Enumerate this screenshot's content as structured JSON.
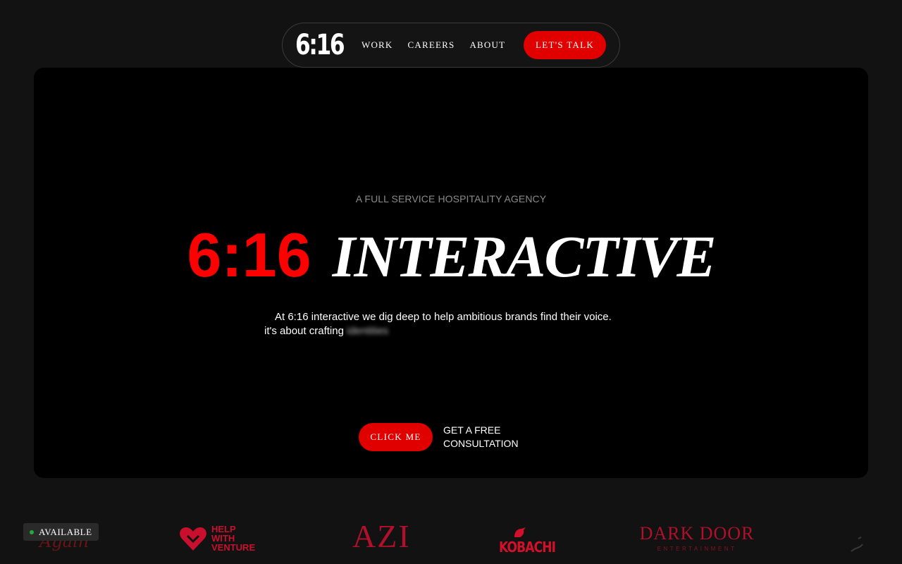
{
  "nav": {
    "logo": "6:16",
    "links": [
      "WORK",
      "CAREERS",
      "ABOUT"
    ],
    "cta": "LET'S TALK"
  },
  "hero": {
    "tagline": "A FULL SERVICE HOSPITALITY AGENCY",
    "headline_number": "6:16",
    "headline_word": "INTERACTIVE",
    "description_line1": "At 6:16 interactive we dig deep to help ambitious brands find their voice.",
    "description_line2": "it's about crafting",
    "description_rotating": "identities",
    "button": "CLICK ME",
    "consultation_line1": "GET A FREE",
    "consultation_line2": "CONSULTATION"
  },
  "logos": {
    "badge": "AVAILABLE",
    "items": [
      {
        "name": "script-logo",
        "text": "Again"
      },
      {
        "name": "help-with-venture",
        "text": "HELP\nWITH\nVENTURE"
      },
      {
        "name": "azi",
        "text": "AZI"
      },
      {
        "name": "kobachi",
        "text": "KOBACHI"
      },
      {
        "name": "dark-door",
        "title": "DARK DOOR",
        "subtitle": "ENTERTAINMENT"
      }
    ]
  },
  "colors": {
    "accent": "#e00000",
    "headline_red": "#ff0000",
    "page_bg": "#121212",
    "hero_bg": "#000000",
    "logo_red": "#b0102a",
    "available_dot": "#1fae3a"
  },
  "icons": [
    "heart-icon",
    "bird-icon",
    "status-dot-icon"
  ]
}
